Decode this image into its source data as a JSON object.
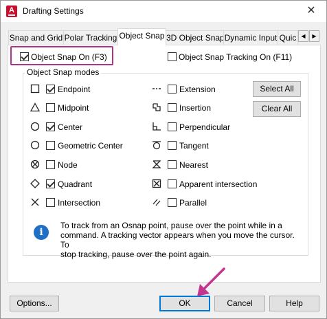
{
  "window": {
    "title": "Drafting Settings",
    "app_icon_letter": "A",
    "close_glyph": "✕"
  },
  "tabs": [
    {
      "label": "Snap and Grid",
      "active": false
    },
    {
      "label": "Polar Tracking",
      "active": false
    },
    {
      "label": "Object Snap",
      "active": true
    },
    {
      "label": "3D Object Snap",
      "active": false
    },
    {
      "label": "Dynamic Input",
      "active": false
    },
    {
      "label": "Quic",
      "active": false
    }
  ],
  "tab_scroll": {
    "left_glyph": "◀",
    "right_glyph": "▶"
  },
  "object_snap_on": {
    "label": "Object Snap On (F3)",
    "checked": true
  },
  "object_snap_tracking_on": {
    "label": "Object Snap Tracking On (F11)",
    "checked": false
  },
  "group": {
    "title": "Object Snap modes"
  },
  "modes_left": [
    {
      "label": "Endpoint",
      "checked": true,
      "icon": "endpoint-icon"
    },
    {
      "label": "Midpoint",
      "checked": false,
      "icon": "midpoint-icon"
    },
    {
      "label": "Center",
      "checked": true,
      "icon": "center-icon"
    },
    {
      "label": "Geometric Center",
      "checked": false,
      "icon": "geometric-center-icon"
    },
    {
      "label": "Node",
      "checked": false,
      "icon": "node-icon"
    },
    {
      "label": "Quadrant",
      "checked": true,
      "icon": "quadrant-icon"
    },
    {
      "label": "Intersection",
      "checked": false,
      "icon": "intersection-icon"
    }
  ],
  "modes_right": [
    {
      "label": "Extension",
      "checked": false,
      "icon": "extension-icon"
    },
    {
      "label": "Insertion",
      "checked": false,
      "icon": "insertion-icon"
    },
    {
      "label": "Perpendicular",
      "checked": false,
      "icon": "perpendicular-icon"
    },
    {
      "label": "Tangent",
      "checked": false,
      "icon": "tangent-icon"
    },
    {
      "label": "Nearest",
      "checked": false,
      "icon": "nearest-icon"
    },
    {
      "label": "Apparent intersection",
      "checked": false,
      "icon": "apparent-intersection-icon"
    },
    {
      "label": "Parallel",
      "checked": false,
      "icon": "parallel-icon"
    }
  ],
  "buttons": {
    "select_all": "Select All",
    "clear_all": "Clear All",
    "options": "Options...",
    "ok": "OK",
    "cancel": "Cancel",
    "help": "Help"
  },
  "info": {
    "icon_glyph": "i",
    "text": "To track from an Osnap point, pause over the point while in a\ncommand.  A tracking vector appears when you move the cursor.  To\nstop tracking, pause over the point again."
  },
  "colors": {
    "highlight": "#b0338a",
    "arrow": "#c2368f",
    "info": "#1e6fc5",
    "default_button_border": "#0078d7"
  }
}
